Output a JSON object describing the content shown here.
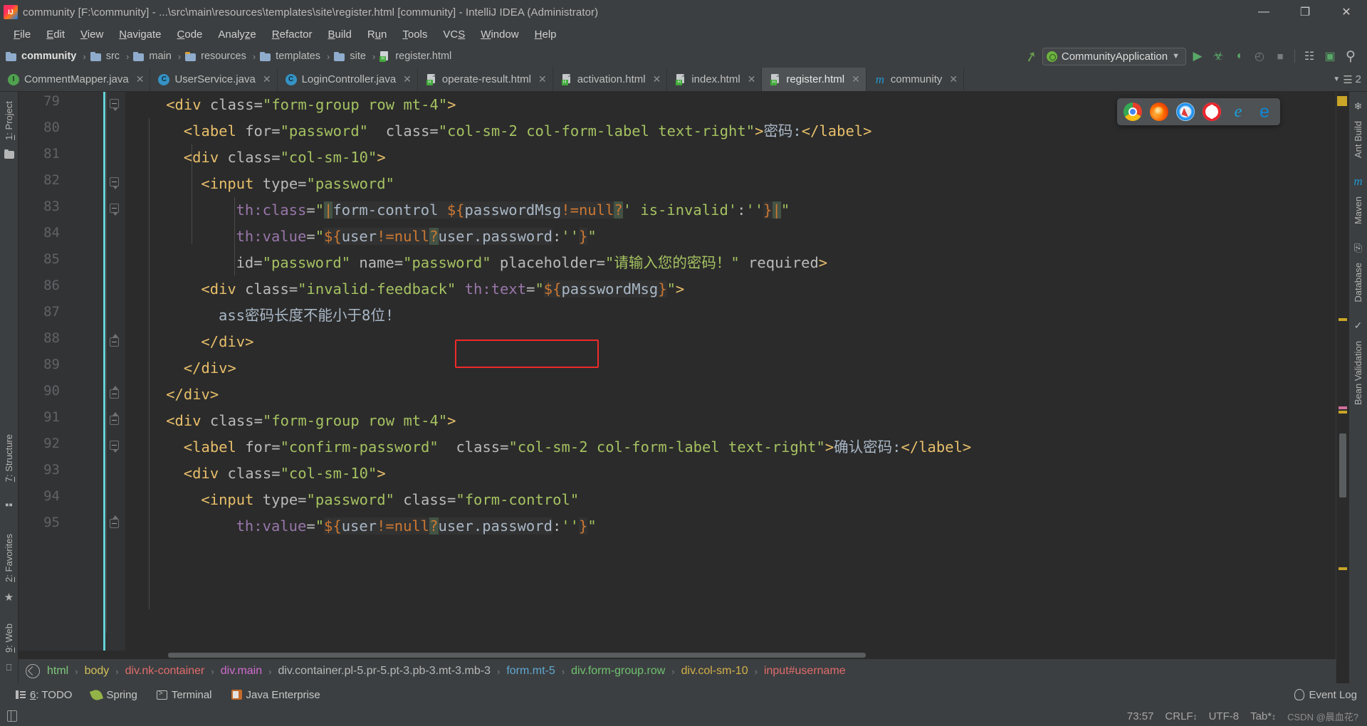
{
  "window": {
    "title": "community [F:\\community] - ...\\src\\main\\resources\\templates\\site\\register.html [community] - IntelliJ IDEA (Administrator)",
    "minimize": "—",
    "maximize": "❐",
    "close": "✕"
  },
  "menu": [
    {
      "label": "File"
    },
    {
      "label": "Edit"
    },
    {
      "label": "View"
    },
    {
      "label": "Navigate"
    },
    {
      "label": "Code"
    },
    {
      "label": "Analyze"
    },
    {
      "label": "Refactor"
    },
    {
      "label": "Build"
    },
    {
      "label": "Run"
    },
    {
      "label": "Tools"
    },
    {
      "label": "VCS"
    },
    {
      "label": "Window"
    },
    {
      "label": "Help"
    }
  ],
  "navbar": {
    "crumbs": [
      {
        "label": "community",
        "icon": "folder-icon",
        "bold": true
      },
      {
        "label": "src",
        "icon": "folder-icon",
        "bold": false
      },
      {
        "label": "main",
        "icon": "folder-icon",
        "bold": false
      },
      {
        "label": "resources",
        "icon": "resources-folder-icon",
        "bold": false
      },
      {
        "label": "templates",
        "icon": "folder-icon",
        "bold": false
      },
      {
        "label": "site",
        "icon": "folder-icon",
        "bold": false
      },
      {
        "label": "register.html",
        "icon": "html-file-icon",
        "bold": false
      }
    ],
    "separator": "›",
    "run_config": "CommunityApplication",
    "dropdown_arrow": "▼",
    "buttons": [
      {
        "name": "run-button",
        "glyph": "▶"
      },
      {
        "name": "debug-button",
        "glyph": "☣"
      },
      {
        "name": "run-coverage-button",
        "glyph": "◗"
      },
      {
        "name": "profile-button",
        "glyph": "◴"
      },
      {
        "name": "stop-button",
        "glyph": "■"
      },
      {
        "name": "project-structure-button",
        "glyph": "▒"
      },
      {
        "name": "updates-button",
        "glyph": "▣"
      },
      {
        "name": "search-everywhere-button",
        "glyph": "⌕"
      }
    ]
  },
  "tabs": [
    {
      "label": "CommentMapper.java",
      "icon": "java-interface-icon",
      "active": false,
      "close": "✕"
    },
    {
      "label": "UserService.java",
      "icon": "java-class-icon",
      "active": false,
      "close": "✕"
    },
    {
      "label": "LoginController.java",
      "icon": "java-class-icon",
      "active": false,
      "close": "✕"
    },
    {
      "label": "operate-result.html",
      "icon": "html-file-icon",
      "active": false,
      "close": "✕"
    },
    {
      "label": "activation.html",
      "icon": "html-file-icon",
      "active": false,
      "close": "✕"
    },
    {
      "label": "index.html",
      "icon": "html-file-icon",
      "active": false,
      "close": "✕"
    },
    {
      "label": "register.html",
      "icon": "html-file-icon",
      "active": true,
      "close": "✕"
    },
    {
      "label": "community",
      "icon": "maven-icon",
      "active": false,
      "close": "✕"
    }
  ],
  "tabbar_right": {
    "arrow": "▼",
    "list": "☰",
    "count": "2"
  },
  "left_strip": {
    "project_label": "1: Project",
    "structure_label": "7: Structure",
    "favorites_label": "2: Favorites",
    "web_label": "9: Web"
  },
  "right_strip": [
    {
      "label": "Ant Build",
      "icon": "ant-icon"
    },
    {
      "label": "Maven",
      "icon": "maven-icon"
    },
    {
      "label": "Database",
      "icon": "database-icon"
    },
    {
      "label": "Bean Validation",
      "icon": "bean-validation-icon"
    }
  ],
  "editor": {
    "first_line": 79,
    "lines": [
      {
        "no": 79,
        "indent": 4,
        "segments": [
          {
            "t": "tag",
            "s": "<div "
          },
          {
            "t": "attr",
            "s": "class"
          },
          {
            "t": "plain",
            "s": "="
          },
          {
            "t": "quote",
            "s": "\""
          },
          {
            "t": "val",
            "s": "form-group row mt-4"
          },
          {
            "t": "quote",
            "s": "\""
          },
          {
            "t": "tag",
            "s": ">"
          }
        ]
      },
      {
        "no": 80,
        "indent": 6,
        "segments": [
          {
            "t": "tag",
            "s": "<label "
          },
          {
            "t": "attr",
            "s": "for"
          },
          {
            "t": "plain",
            "s": "="
          },
          {
            "t": "quote",
            "s": "\""
          },
          {
            "t": "val",
            "s": "password"
          },
          {
            "t": "quote",
            "s": "\""
          },
          {
            "t": "plain",
            "s": "  "
          },
          {
            "t": "attr",
            "s": "class"
          },
          {
            "t": "plain",
            "s": "="
          },
          {
            "t": "quote",
            "s": "\""
          },
          {
            "t": "val",
            "s": "col-sm-2 col-form-label text-right"
          },
          {
            "t": "quote",
            "s": "\""
          },
          {
            "t": "tag",
            "s": ">"
          },
          {
            "t": "txt",
            "s": "密码:"
          },
          {
            "t": "tag",
            "s": "</label>"
          }
        ]
      },
      {
        "no": 81,
        "indent": 6,
        "segments": [
          {
            "t": "tag",
            "s": "<div "
          },
          {
            "t": "attr",
            "s": "class"
          },
          {
            "t": "plain",
            "s": "="
          },
          {
            "t": "quote",
            "s": "\""
          },
          {
            "t": "val",
            "s": "col-sm-10"
          },
          {
            "t": "quote",
            "s": "\""
          },
          {
            "t": "tag",
            "s": ">"
          }
        ]
      },
      {
        "no": 82,
        "indent": 8,
        "segments": [
          {
            "t": "tag",
            "s": "<input "
          },
          {
            "t": "attr",
            "s": "type"
          },
          {
            "t": "plain",
            "s": "="
          },
          {
            "t": "quote",
            "s": "\""
          },
          {
            "t": "val",
            "s": "password"
          },
          {
            "t": "quote",
            "s": "\""
          }
        ]
      },
      {
        "no": 83,
        "indent": 12,
        "segments": [
          {
            "t": "thattr",
            "s": "th:class"
          },
          {
            "t": "plain",
            "s": "="
          },
          {
            "t": "quote",
            "s": "\""
          },
          {
            "t": "ins",
            "s": "|"
          },
          {
            "t": "el",
            "s": "form-control "
          },
          {
            "t": "dollar",
            "s": "${"
          },
          {
            "t": "el",
            "s": "passwordMsg"
          },
          {
            "t": "kw",
            "s": "!="
          },
          {
            "t": "kw",
            "s": "null"
          },
          {
            "t": "ins",
            "s": "?"
          },
          {
            "t": "val",
            "s": "' is-invalid'"
          },
          {
            "t": "plain",
            "s": ":"
          },
          {
            "t": "val",
            "s": "''"
          },
          {
            "t": "brace",
            "s": "}"
          },
          {
            "t": "ins",
            "s": "|"
          },
          {
            "t": "quote",
            "s": "\""
          }
        ]
      },
      {
        "no": 84,
        "indent": 12,
        "segments": [
          {
            "t": "thattr",
            "s": "th:value"
          },
          {
            "t": "plain",
            "s": "="
          },
          {
            "t": "quote",
            "s": "\""
          },
          {
            "t": "dollar",
            "s": "${"
          },
          {
            "t": "el",
            "s": "user"
          },
          {
            "t": "kw",
            "s": "!="
          },
          {
            "t": "kw",
            "s": "null"
          },
          {
            "t": "ins",
            "s": "?"
          },
          {
            "t": "el",
            "s": "user.password"
          },
          {
            "t": "plain",
            "s": ":"
          },
          {
            "t": "val",
            "s": "''"
          },
          {
            "t": "brace",
            "s": "}"
          },
          {
            "t": "quote",
            "s": "\""
          }
        ]
      },
      {
        "no": 85,
        "indent": 12,
        "segments": [
          {
            "t": "attr",
            "s": "id"
          },
          {
            "t": "plain",
            "s": "="
          },
          {
            "t": "quote",
            "s": "\""
          },
          {
            "t": "val",
            "s": "password"
          },
          {
            "t": "quote",
            "s": "\""
          },
          {
            "t": "plain",
            "s": " "
          },
          {
            "t": "attr",
            "s": "name"
          },
          {
            "t": "plain",
            "s": "="
          },
          {
            "t": "quote",
            "s": "\""
          },
          {
            "t": "val",
            "s": "password"
          },
          {
            "t": "quote",
            "s": "\""
          },
          {
            "t": "plain",
            "s": " "
          },
          {
            "t": "attr",
            "s": "placeholder"
          },
          {
            "t": "plain",
            "s": "="
          },
          {
            "t": "quote",
            "s": "\""
          },
          {
            "t": "val",
            "s": "请输入您的密码！"
          },
          {
            "t": "quote",
            "s": "\""
          },
          {
            "t": "plain",
            "s": " "
          },
          {
            "t": "attr",
            "s": "required"
          },
          {
            "t": "tag",
            "s": ">"
          }
        ]
      },
      {
        "no": 86,
        "indent": 8,
        "segments": [
          {
            "t": "tag",
            "s": "<div "
          },
          {
            "t": "attr",
            "s": "class"
          },
          {
            "t": "plain",
            "s": "="
          },
          {
            "t": "quote",
            "s": "\""
          },
          {
            "t": "val",
            "s": "invalid-feedback"
          },
          {
            "t": "quote",
            "s": "\""
          },
          {
            "t": "plain",
            "s": " "
          },
          {
            "t": "thattr",
            "s": "th:text"
          },
          {
            "t": "plain",
            "s": "="
          },
          {
            "t": "quote",
            "s": "\""
          },
          {
            "t": "dollar",
            "s": "${"
          },
          {
            "t": "el",
            "s": "passwordMsg"
          },
          {
            "t": "brace",
            "s": "}"
          },
          {
            "t": "quote",
            "s": "\""
          },
          {
            "t": "tag",
            "s": ">"
          }
        ]
      },
      {
        "no": 87,
        "indent": 10,
        "segments": [
          {
            "t": "txt",
            "s": "ass密码长度不能小于8位!"
          }
        ]
      },
      {
        "no": 88,
        "indent": 8,
        "segments": [
          {
            "t": "tag",
            "s": "</div>"
          }
        ]
      },
      {
        "no": 89,
        "indent": 6,
        "segments": [
          {
            "t": "tag",
            "s": "</div>"
          }
        ]
      },
      {
        "no": 90,
        "indent": 4,
        "segments": [
          {
            "t": "tag",
            "s": "</div>"
          }
        ]
      },
      {
        "no": 91,
        "indent": 4,
        "segments": [
          {
            "t": "tag",
            "s": "<div "
          },
          {
            "t": "attr",
            "s": "class"
          },
          {
            "t": "plain",
            "s": "="
          },
          {
            "t": "quote",
            "s": "\""
          },
          {
            "t": "val",
            "s": "form-group row mt-4"
          },
          {
            "t": "quote",
            "s": "\""
          },
          {
            "t": "tag",
            "s": ">"
          }
        ]
      },
      {
        "no": 92,
        "indent": 6,
        "segments": [
          {
            "t": "tag",
            "s": "<label "
          },
          {
            "t": "attr",
            "s": "for"
          },
          {
            "t": "plain",
            "s": "="
          },
          {
            "t": "quote",
            "s": "\""
          },
          {
            "t": "val",
            "s": "confirm-password"
          },
          {
            "t": "quote",
            "s": "\""
          },
          {
            "t": "plain",
            "s": "  "
          },
          {
            "t": "attr",
            "s": "class"
          },
          {
            "t": "plain",
            "s": "="
          },
          {
            "t": "quote",
            "s": "\""
          },
          {
            "t": "val",
            "s": "col-sm-2 col-form-label text-right"
          },
          {
            "t": "quote",
            "s": "\""
          },
          {
            "t": "tag",
            "s": ">"
          },
          {
            "t": "txt",
            "s": "确认密码:"
          },
          {
            "t": "tag",
            "s": "</label>"
          }
        ]
      },
      {
        "no": 93,
        "indent": 6,
        "segments": [
          {
            "t": "tag",
            "s": "<div "
          },
          {
            "t": "attr",
            "s": "class"
          },
          {
            "t": "plain",
            "s": "="
          },
          {
            "t": "quote",
            "s": "\""
          },
          {
            "t": "val",
            "s": "col-sm-10"
          },
          {
            "t": "quote",
            "s": "\""
          },
          {
            "t": "tag",
            "s": ">"
          }
        ]
      },
      {
        "no": 94,
        "indent": 8,
        "segments": [
          {
            "t": "tag",
            "s": "<input "
          },
          {
            "t": "attr",
            "s": "type"
          },
          {
            "t": "plain",
            "s": "="
          },
          {
            "t": "quote",
            "s": "\""
          },
          {
            "t": "val",
            "s": "password"
          },
          {
            "t": "quote",
            "s": "\""
          },
          {
            "t": "plain",
            "s": " "
          },
          {
            "t": "attr",
            "s": "class"
          },
          {
            "t": "plain",
            "s": "="
          },
          {
            "t": "quote",
            "s": "\""
          },
          {
            "t": "val",
            "s": "form-control"
          },
          {
            "t": "quote",
            "s": "\""
          }
        ]
      },
      {
        "no": 95,
        "indent": 12,
        "segments": [
          {
            "t": "thattr",
            "s": "th:value"
          },
          {
            "t": "plain",
            "s": "="
          },
          {
            "t": "quote",
            "s": "\""
          },
          {
            "t": "dollar",
            "s": "${"
          },
          {
            "t": "el",
            "s": "user"
          },
          {
            "t": "kw",
            "s": "!="
          },
          {
            "t": "kw",
            "s": "null"
          },
          {
            "t": "ins",
            "s": "?"
          },
          {
            "t": "el",
            "s": "user.password"
          },
          {
            "t": "plain",
            "s": ":"
          },
          {
            "t": "val",
            "s": "''"
          },
          {
            "t": "brace",
            "s": "}"
          },
          {
            "t": "quote",
            "s": "\""
          }
        ]
      }
    ],
    "highlight_box": {
      "label": "name-attribute-highlight",
      "color": "#f02a2a"
    }
  },
  "browser_popup": {
    "items": [
      {
        "name": "chrome-icon",
        "label": "Chrome"
      },
      {
        "name": "firefox-icon",
        "label": "Firefox"
      },
      {
        "name": "safari-icon",
        "label": "Safari"
      },
      {
        "name": "opera-icon",
        "label": "Opera"
      },
      {
        "name": "internet-explorer-icon",
        "label": "Internet Explorer"
      },
      {
        "name": "edge-icon",
        "label": "Edge"
      }
    ]
  },
  "breadcrumb_bar": {
    "separator": "›",
    "items": [
      {
        "label": "html",
        "cls": "cb-html"
      },
      {
        "label": "body",
        "cls": "cb-body"
      },
      {
        "label": "div.nk-container",
        "cls": "cb-red"
      },
      {
        "label": "div.main",
        "cls": "cb-pink"
      },
      {
        "label": "div.container.pl-5.pr-5.pt-3.pb-3.mt-3.mb-3",
        "cls": "cb-grey"
      },
      {
        "label": "form.mt-5",
        "cls": "cb-blue"
      },
      {
        "label": "div.form-group.row",
        "cls": "cb-green"
      },
      {
        "label": "div.col-sm-10",
        "cls": "cb-gold"
      },
      {
        "label": "input#username",
        "cls": "cb-red"
      }
    ]
  },
  "bottom_bar": {
    "windows": [
      {
        "label": "6: TODO",
        "icon": "todo-icon"
      },
      {
        "label": "Spring",
        "icon": "spring-icon"
      },
      {
        "label": "Terminal",
        "icon": "terminal-icon"
      },
      {
        "label": "Java Enterprise",
        "icon": "java-enterprise-icon"
      }
    ],
    "event_log": "Event Log"
  },
  "status_bar": {
    "position": "73:57",
    "line_separator": "CRLF",
    "line_separator_arrow": "↕",
    "encoding": "UTF-8",
    "indent": "Tab*",
    "indent_arrow": "↕",
    "watermark": "CSDN @晨血花?"
  }
}
